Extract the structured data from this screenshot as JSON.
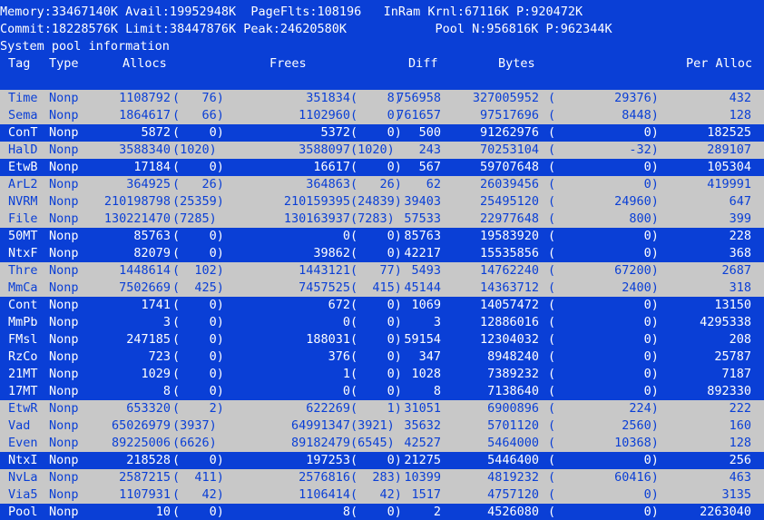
{
  "status": {
    "line1": "Memory:33467140K Avail:19952948K  PageFlts:108196   InRam Krnl:67116K P:920472K",
    "line2": "Commit:18228576K Limit:38447876K Peak:24620580K            Pool N:956816K P:962344K",
    "line3": "System pool information"
  },
  "headers": {
    "tag": "Tag",
    "type": "Type",
    "allocs": "Allocs",
    "frees": "Frees",
    "diff": "Diff",
    "bytes": "Bytes",
    "per_alloc": "Per Alloc"
  },
  "rows": [
    {
      "tag": "Time",
      "type": "Nonp",
      "allocs": "1108792",
      "allocs_p": "(   76)",
      "frees": "351834",
      "frees_p": "(    8)",
      "diff": "756958",
      "bytes": "327005952",
      "bytes_p": "(        29376)",
      "per": "432",
      "style": "grey"
    },
    {
      "tag": "Sema",
      "type": "Nonp",
      "allocs": "1864617",
      "allocs_p": "(   66)",
      "frees": "1102960",
      "frees_p": "(    0)",
      "diff": "761657",
      "bytes": "97517696",
      "bytes_p": "(         8448)",
      "per": "128",
      "style": "grey"
    },
    {
      "tag": "ConT",
      "type": "Nonp",
      "allocs": "5872",
      "allocs_p": "(    0)",
      "frees": "5372",
      "frees_p": "(    0)",
      "diff": "500",
      "bytes": "91262976",
      "bytes_p": "(            0)",
      "per": "182525",
      "style": "blue"
    },
    {
      "tag": "HalD",
      "type": "Nonp",
      "allocs": "3588340",
      "allocs_p": "(1020)",
      "frees": "3588097",
      "frees_p": "(1020)",
      "diff": "243",
      "bytes": "70253104",
      "bytes_p": "(          -32)",
      "per": "289107",
      "style": "grey"
    },
    {
      "tag": "EtwB",
      "type": "Nonp",
      "allocs": "17184",
      "allocs_p": "(    0)",
      "frees": "16617",
      "frees_p": "(    0)",
      "diff": "567",
      "bytes": "59707648",
      "bytes_p": "(            0)",
      "per": "105304",
      "style": "blue"
    },
    {
      "tag": "ArL2",
      "type": "Nonp",
      "allocs": "364925",
      "allocs_p": "(   26)",
      "frees": "364863",
      "frees_p": "(   26)",
      "diff": "62",
      "bytes": "26039456",
      "bytes_p": "(            0)",
      "per": "419991",
      "style": "grey"
    },
    {
      "tag": "NVRM",
      "type": "Nonp",
      "allocs": "210198798",
      "allocs_p": "(25359)",
      "frees": "210159395",
      "frees_p": "(24839)",
      "diff": "39403",
      "bytes": "25495120",
      "bytes_p": "(        24960)",
      "per": "647",
      "style": "grey"
    },
    {
      "tag": "File",
      "type": "Nonp",
      "allocs": "130221470",
      "allocs_p": "(7285)",
      "frees": "130163937",
      "frees_p": "(7283)",
      "diff": "57533",
      "bytes": "22977648",
      "bytes_p": "(          800)",
      "per": "399",
      "style": "grey"
    },
    {
      "tag": "50MT",
      "type": "Nonp",
      "allocs": "85763",
      "allocs_p": "(    0)",
      "frees": "0",
      "frees_p": "(    0)",
      "diff": "85763",
      "bytes": "19583920",
      "bytes_p": "(            0)",
      "per": "228",
      "style": "blue"
    },
    {
      "tag": "NtxF",
      "type": "Nonp",
      "allocs": "82079",
      "allocs_p": "(    0)",
      "frees": "39862",
      "frees_p": "(    0)",
      "diff": "42217",
      "bytes": "15535856",
      "bytes_p": "(            0)",
      "per": "368",
      "style": "blue"
    },
    {
      "tag": "Thre",
      "type": "Nonp",
      "allocs": "1448614",
      "allocs_p": "(  102)",
      "frees": "1443121",
      "frees_p": "(   77)",
      "diff": "5493",
      "bytes": "14762240",
      "bytes_p": "(        67200)",
      "per": "2687",
      "style": "grey"
    },
    {
      "tag": "MmCa",
      "type": "Nonp",
      "allocs": "7502669",
      "allocs_p": "(  425)",
      "frees": "7457525",
      "frees_p": "(  415)",
      "diff": "45144",
      "bytes": "14363712",
      "bytes_p": "(         2400)",
      "per": "318",
      "style": "grey"
    },
    {
      "tag": "Cont",
      "type": "Nonp",
      "allocs": "1741",
      "allocs_p": "(    0)",
      "frees": "672",
      "frees_p": "(    0)",
      "diff": "1069",
      "bytes": "14057472",
      "bytes_p": "(            0)",
      "per": "13150",
      "style": "blue"
    },
    {
      "tag": "MmPb",
      "type": "Nonp",
      "allocs": "3",
      "allocs_p": "(    0)",
      "frees": "0",
      "frees_p": "(    0)",
      "diff": "3",
      "bytes": "12886016",
      "bytes_p": "(            0)",
      "per": "4295338",
      "style": "blue"
    },
    {
      "tag": "FMsl",
      "type": "Nonp",
      "allocs": "247185",
      "allocs_p": "(    0)",
      "frees": "188031",
      "frees_p": "(    0)",
      "diff": "59154",
      "bytes": "12304032",
      "bytes_p": "(            0)",
      "per": "208",
      "style": "blue"
    },
    {
      "tag": "RzCo",
      "type": "Nonp",
      "allocs": "723",
      "allocs_p": "(    0)",
      "frees": "376",
      "frees_p": "(    0)",
      "diff": "347",
      "bytes": "8948240",
      "bytes_p": "(            0)",
      "per": "25787",
      "style": "blue"
    },
    {
      "tag": "21MT",
      "type": "Nonp",
      "allocs": "1029",
      "allocs_p": "(    0)",
      "frees": "1",
      "frees_p": "(    0)",
      "diff": "1028",
      "bytes": "7389232",
      "bytes_p": "(            0)",
      "per": "7187",
      "style": "blue"
    },
    {
      "tag": "17MT",
      "type": "Nonp",
      "allocs": "8",
      "allocs_p": "(    0)",
      "frees": "0",
      "frees_p": "(    0)",
      "diff": "8",
      "bytes": "7138640",
      "bytes_p": "(            0)",
      "per": "892330",
      "style": "blue"
    },
    {
      "tag": "EtwR",
      "type": "Nonp",
      "allocs": "653320",
      "allocs_p": "(    2)",
      "frees": "622269",
      "frees_p": "(    1)",
      "diff": "31051",
      "bytes": "6900896",
      "bytes_p": "(          224)",
      "per": "222",
      "style": "grey"
    },
    {
      "tag": "Vad",
      "type": "Nonp",
      "allocs": "65026979",
      "allocs_p": "(3937)",
      "frees": "64991347",
      "frees_p": "(3921)",
      "diff": "35632",
      "bytes": "5701120",
      "bytes_p": "(         2560)",
      "per": "160",
      "style": "grey"
    },
    {
      "tag": "Even",
      "type": "Nonp",
      "allocs": "89225006",
      "allocs_p": "(6626)",
      "frees": "89182479",
      "frees_p": "(6545)",
      "diff": "42527",
      "bytes": "5464000",
      "bytes_p": "(        10368)",
      "per": "128",
      "style": "grey"
    },
    {
      "tag": "NtxI",
      "type": "Nonp",
      "allocs": "218528",
      "allocs_p": "(    0)",
      "frees": "197253",
      "frees_p": "(    0)",
      "diff": "21275",
      "bytes": "5446400",
      "bytes_p": "(            0)",
      "per": "256",
      "style": "blue"
    },
    {
      "tag": "NvLa",
      "type": "Nonp",
      "allocs": "2587215",
      "allocs_p": "(  411)",
      "frees": "2576816",
      "frees_p": "(  283)",
      "diff": "10399",
      "bytes": "4819232",
      "bytes_p": "(        60416)",
      "per": "463",
      "style": "grey"
    },
    {
      "tag": "Via5",
      "type": "Nonp",
      "allocs": "1107931",
      "allocs_p": "(   42)",
      "frees": "1106414",
      "frees_p": "(   42)",
      "diff": "1517",
      "bytes": "4757120",
      "bytes_p": "(            0)",
      "per": "3135",
      "style": "grey"
    },
    {
      "tag": "Pool",
      "type": "Nonp",
      "allocs": "10",
      "allocs_p": "(    0)",
      "frees": "8",
      "frees_p": "(    0)",
      "diff": "2",
      "bytes": "4526080",
      "bytes_p": "(            0)",
      "per": "2263040",
      "style": "blue"
    }
  ]
}
